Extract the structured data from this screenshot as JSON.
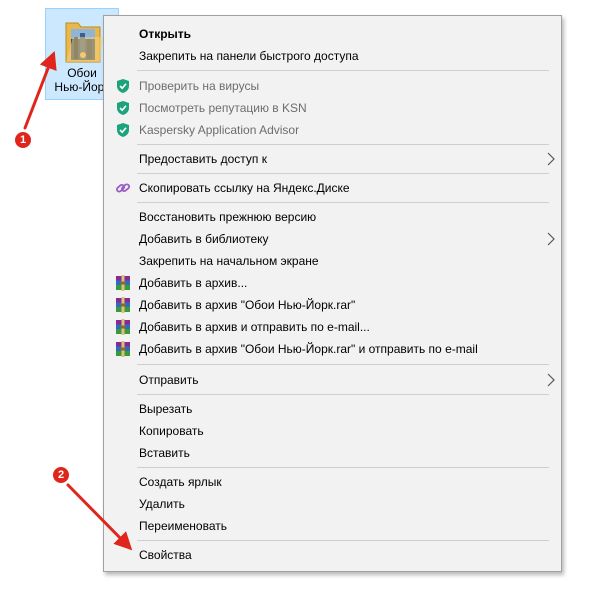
{
  "desktop": {
    "folder_label_line1": "Обои",
    "folder_label_line2": "Нью-Йорк",
    "folder_icon": "folder-with-picture-icon"
  },
  "context_menu": {
    "items": {
      "open": "Открыть",
      "pin_quick_access": "Закрепить на панели быстрого доступа",
      "scan_viruses": "Проверить на вирусы",
      "check_ksn": "Посмотреть репутацию в KSN",
      "kaspersky_advisor": "Kaspersky Application Advisor",
      "give_access": "Предоставить доступ к",
      "copy_yandex_link": "Скопировать ссылку на Яндекс.Диске",
      "restore_version": "Восстановить прежнюю версию",
      "add_to_library": "Добавить в библиотеку",
      "pin_start": "Закрепить на начальном экране",
      "add_archive": "Добавить в архив...",
      "add_archive_named": "Добавить в архив \"Обои Нью-Йорк.rar\"",
      "add_archive_email": "Добавить в архив и отправить по e-mail...",
      "add_archive_named_email": "Добавить в архив \"Обои Нью-Йорк.rar\" и отправить по e-mail",
      "send_to": "Отправить",
      "cut": "Вырезать",
      "copy": "Копировать",
      "paste": "Вставить",
      "create_shortcut": "Создать ярлык",
      "delete": "Удалить",
      "rename": "Переименовать",
      "properties": "Свойства"
    },
    "icons": {
      "kaspersky": "kaspersky-shield-icon",
      "yandex": "yandex-disk-link-icon",
      "winrar": "winrar-archive-icon",
      "submenu": "chevron-right-icon"
    }
  },
  "annotations": {
    "badge1": "1",
    "badge2": "2",
    "accent_color": "#e0261c"
  }
}
